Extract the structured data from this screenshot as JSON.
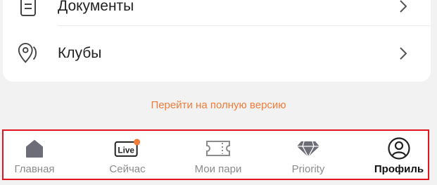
{
  "menu": {
    "documents_label": "Документы",
    "clubs_label": "Клубы"
  },
  "footer": {
    "full_version_link": "Перейти на полную версию"
  },
  "tabbar": {
    "tabs": [
      {
        "label": "Главная",
        "icon": "home-icon"
      },
      {
        "label": "Сейчас",
        "icon": "live-icon"
      },
      {
        "label": "Мои пари",
        "icon": "ticket-icon"
      },
      {
        "label": "Priority",
        "icon": "diamond-icon"
      },
      {
        "label": "Профиль",
        "icon": "profile-icon",
        "active": true
      }
    ],
    "live_badge_text": "Live",
    "accent_color": "#f07c3a",
    "highlight_border_color": "#e2141d"
  }
}
